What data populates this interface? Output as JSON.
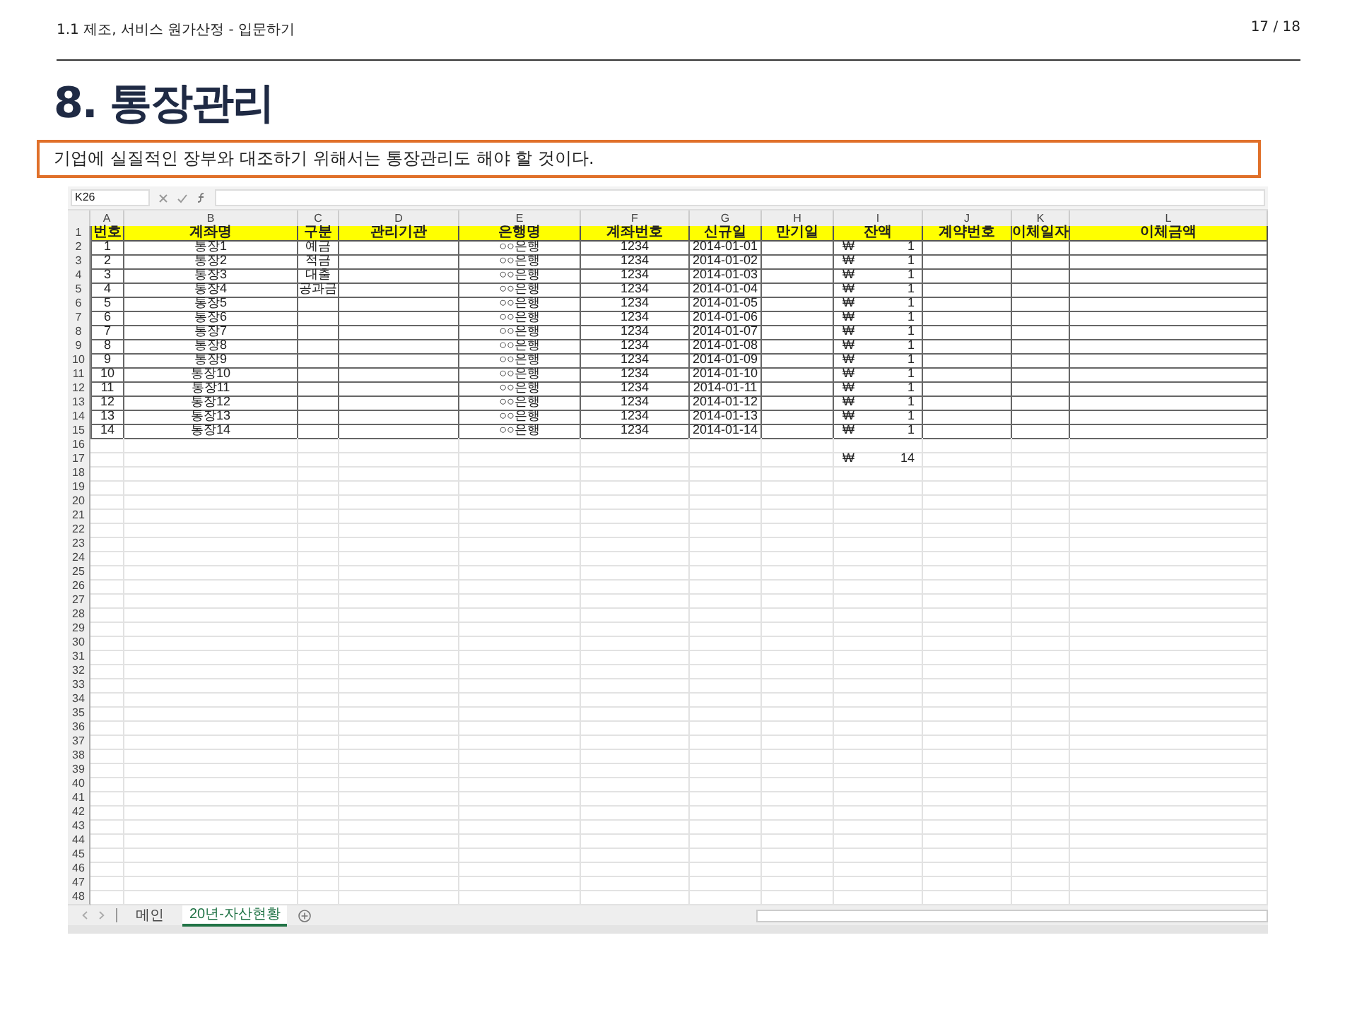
{
  "header": {
    "section": "1.1 제조, 서비스 원가산정 - 입문하기",
    "page": "17 / 18"
  },
  "title": "8. 통장관리",
  "subtitle": "기업에 실질적인 장부와 대조하기 위해서는 통장관리도 해야 할 것이다.",
  "sheet": {
    "name_box": "K26",
    "columns": [
      "A",
      "B",
      "C",
      "D",
      "E",
      "F",
      "G",
      "H",
      "I",
      "J",
      "K",
      "L"
    ],
    "rows": [
      {
        "row": "1",
        "kind": "header",
        "cells": {
          "A": "번호",
          "B": "계좌명",
          "C": "구분",
          "D": "관리기관",
          "E": "은행명",
          "F": "계좌번호",
          "G": "신규일",
          "H": "만기일",
          "I": "잔액",
          "J": "계약번호",
          "K": "이체일자",
          "L": "이체금액"
        }
      },
      {
        "row": "2",
        "kind": "data",
        "cells": {
          "A": "1",
          "B": "통장1",
          "C": "예금",
          "E": "○○은행",
          "F": "1234",
          "G": "2014-01-01",
          "I": {
            "symbol": "₩",
            "amount": "1"
          }
        }
      },
      {
        "row": "3",
        "kind": "data",
        "cells": {
          "A": "2",
          "B": "통장2",
          "C": "적금",
          "E": "○○은행",
          "F": "1234",
          "G": "2014-01-02",
          "I": {
            "symbol": "₩",
            "amount": "1"
          }
        }
      },
      {
        "row": "4",
        "kind": "data",
        "cells": {
          "A": "3",
          "B": "통장3",
          "C": "대출",
          "E": "○○은행",
          "F": "1234",
          "G": "2014-01-03",
          "I": {
            "symbol": "₩",
            "amount": "1"
          }
        }
      },
      {
        "row": "5",
        "kind": "data",
        "cells": {
          "A": "4",
          "B": "통장4",
          "C": "공과금",
          "E": "○○은행",
          "F": "1234",
          "G": "2014-01-04",
          "I": {
            "symbol": "₩",
            "amount": "1"
          }
        }
      },
      {
        "row": "6",
        "kind": "data",
        "cells": {
          "A": "5",
          "B": "통장5",
          "E": "○○은행",
          "F": "1234",
          "G": "2014-01-05",
          "I": {
            "symbol": "₩",
            "amount": "1"
          }
        }
      },
      {
        "row": "7",
        "kind": "data",
        "cells": {
          "A": "6",
          "B": "통장6",
          "E": "○○은행",
          "F": "1234",
          "G": "2014-01-06",
          "I": {
            "symbol": "₩",
            "amount": "1"
          }
        }
      },
      {
        "row": "8",
        "kind": "data",
        "cells": {
          "A": "7",
          "B": "통장7",
          "E": "○○은행",
          "F": "1234",
          "G": "2014-01-07",
          "I": {
            "symbol": "₩",
            "amount": "1"
          }
        }
      },
      {
        "row": "9",
        "kind": "data",
        "cells": {
          "A": "8",
          "B": "통장8",
          "E": "○○은행",
          "F": "1234",
          "G": "2014-01-08",
          "I": {
            "symbol": "₩",
            "amount": "1"
          }
        }
      },
      {
        "row": "10",
        "kind": "data",
        "cells": {
          "A": "9",
          "B": "통장9",
          "E": "○○은행",
          "F": "1234",
          "G": "2014-01-09",
          "I": {
            "symbol": "₩",
            "amount": "1"
          }
        }
      },
      {
        "row": "11",
        "kind": "data",
        "cells": {
          "A": "10",
          "B": "통장10",
          "E": "○○은행",
          "F": "1234",
          "G": "2014-01-10",
          "I": {
            "symbol": "₩",
            "amount": "1"
          }
        }
      },
      {
        "row": "12",
        "kind": "data",
        "cells": {
          "A": "11",
          "B": "통장11",
          "E": "○○은행",
          "F": "1234",
          "G": "2014-01-11",
          "I": {
            "symbol": "₩",
            "amount": "1"
          }
        }
      },
      {
        "row": "13",
        "kind": "data",
        "cells": {
          "A": "12",
          "B": "통장12",
          "E": "○○은행",
          "F": "1234",
          "G": "2014-01-12",
          "I": {
            "symbol": "₩",
            "amount": "1"
          }
        }
      },
      {
        "row": "14",
        "kind": "data",
        "cells": {
          "A": "13",
          "B": "통장13",
          "E": "○○은행",
          "F": "1234",
          "G": "2014-01-13",
          "I": {
            "symbol": "₩",
            "amount": "1"
          }
        }
      },
      {
        "row": "15",
        "kind": "data",
        "cells": {
          "A": "14",
          "B": "통장14",
          "E": "○○은행",
          "F": "1234",
          "G": "2014-01-14",
          "I": {
            "symbol": "₩",
            "amount": "1"
          }
        }
      },
      {
        "row": "16",
        "kind": "blank",
        "cells": {}
      },
      {
        "row": "17",
        "kind": "blank",
        "cells": {
          "I": {
            "symbol": "₩",
            "amount": "14"
          }
        }
      },
      {
        "row": "18",
        "kind": "blank",
        "cells": {}
      },
      {
        "row": "19",
        "kind": "blank",
        "cells": {}
      },
      {
        "row": "20",
        "kind": "blank",
        "cells": {}
      },
      {
        "row": "21",
        "kind": "blank",
        "cells": {}
      },
      {
        "row": "22",
        "kind": "blank",
        "cells": {}
      },
      {
        "row": "23",
        "kind": "blank",
        "cells": {}
      },
      {
        "row": "24",
        "kind": "blank",
        "cells": {}
      },
      {
        "row": "25",
        "kind": "blank",
        "cells": {}
      },
      {
        "row": "26",
        "kind": "blank",
        "cells": {}
      },
      {
        "row": "27",
        "kind": "blank",
        "cells": {}
      },
      {
        "row": "28",
        "kind": "blank",
        "cells": {}
      },
      {
        "row": "29",
        "kind": "blank",
        "cells": {}
      },
      {
        "row": "30",
        "kind": "blank",
        "cells": {}
      },
      {
        "row": "31",
        "kind": "blank",
        "cells": {}
      },
      {
        "row": "32",
        "kind": "blank",
        "cells": {}
      },
      {
        "row": "33",
        "kind": "blank",
        "cells": {}
      },
      {
        "row": "34",
        "kind": "blank",
        "cells": {}
      },
      {
        "row": "35",
        "kind": "blank",
        "cells": {}
      },
      {
        "row": "36",
        "kind": "blank",
        "cells": {}
      },
      {
        "row": "37",
        "kind": "blank",
        "cells": {}
      },
      {
        "row": "38",
        "kind": "blank",
        "cells": {}
      },
      {
        "row": "39",
        "kind": "blank",
        "cells": {}
      },
      {
        "row": "40",
        "kind": "blank",
        "cells": {}
      },
      {
        "row": "41",
        "kind": "blank",
        "cells": {}
      },
      {
        "row": "42",
        "kind": "blank",
        "cells": {}
      },
      {
        "row": "43",
        "kind": "blank",
        "cells": {}
      },
      {
        "row": "44",
        "kind": "blank",
        "cells": {}
      },
      {
        "row": "45",
        "kind": "blank",
        "cells": {}
      },
      {
        "row": "46",
        "kind": "blank",
        "cells": {}
      },
      {
        "row": "47",
        "kind": "blank",
        "cells": {}
      },
      {
        "row": "48",
        "kind": "blank",
        "cells": {}
      }
    ],
    "tabs": [
      {
        "label": "메인",
        "selected": false
      },
      {
        "label": "20년-자산현황",
        "selected": true
      }
    ]
  }
}
